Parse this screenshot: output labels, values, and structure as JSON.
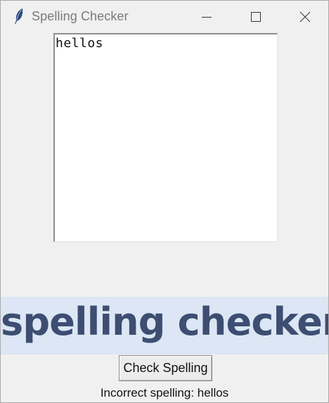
{
  "window": {
    "title": "Spelling Checker",
    "controls": {
      "minimize_icon": "minimize-icon",
      "maximize_icon": "maximize-icon",
      "close_icon": "close-icon"
    },
    "app_icon": "feather-icon"
  },
  "editor": {
    "text": "hellos"
  },
  "banner": {
    "text": "spelling checker",
    "background": "#dce6f4",
    "color": "#3d4e72"
  },
  "actions": {
    "check_label": "Check Spelling"
  },
  "result": {
    "text": "Incorrect spelling: hellos"
  }
}
